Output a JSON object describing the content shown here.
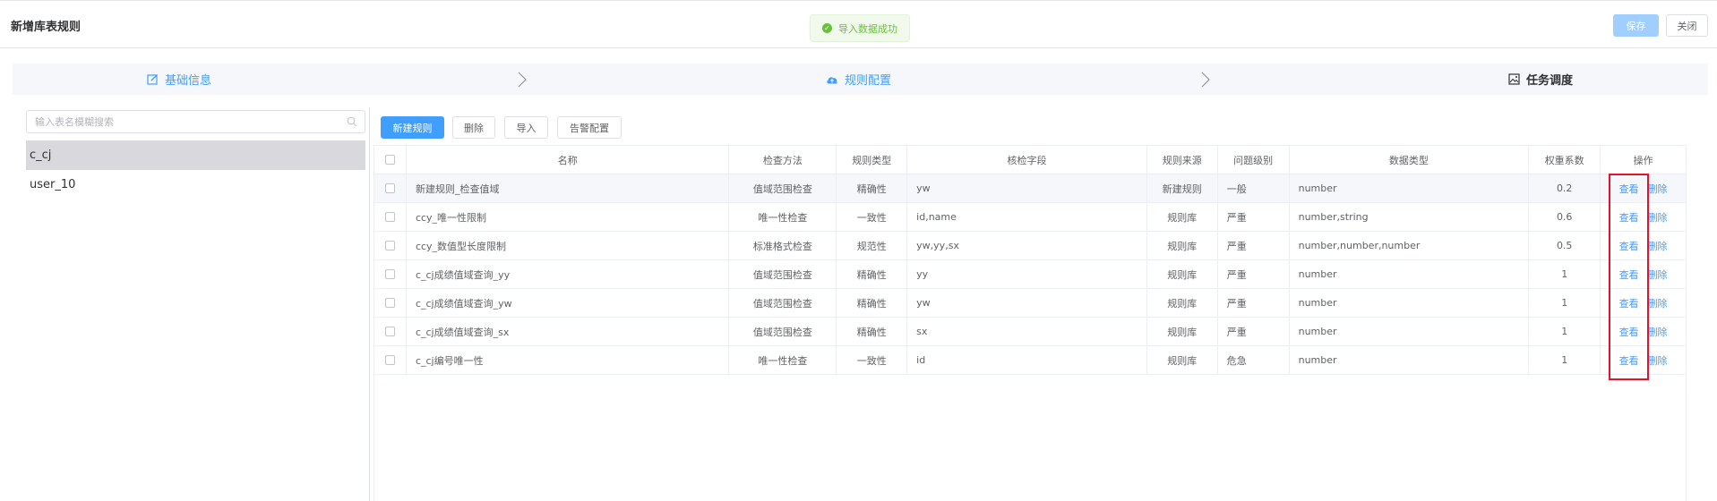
{
  "header": {
    "title": "新增库表规则",
    "toast": "导入数据成功",
    "save_label": "保存",
    "close_label": "关闭"
  },
  "steps": [
    {
      "label": "基础信息",
      "icon": "edit-icon",
      "state": "done"
    },
    {
      "label": "规则配置",
      "icon": "cloud-upload-icon",
      "state": "done"
    },
    {
      "label": "任务调度",
      "icon": "picture-icon",
      "state": "current"
    }
  ],
  "sidebar": {
    "search_placeholder": "输入表名模糊搜索",
    "tables": [
      {
        "name": "c_cj",
        "selected": true
      },
      {
        "name": "user_10",
        "selected": false
      }
    ]
  },
  "toolbar": {
    "new_rule": "新建规则",
    "delete": "删除",
    "import": "导入",
    "alarm_config": "告警配置"
  },
  "table": {
    "columns": [
      "名称",
      "检查方法",
      "规则类型",
      "核检字段",
      "规则来源",
      "问题级别",
      "数据类型",
      "权重系数",
      "操作"
    ],
    "rows": [
      {
        "name": "新建规则_检查值域",
        "method": "值域范围检查",
        "type": "精确性",
        "field": "yw",
        "source": "新建规则",
        "level": "一般",
        "dtype": "number",
        "weight": "0.2"
      },
      {
        "name": "ccy_唯一性限制",
        "method": "唯一性检查",
        "type": "一致性",
        "field": "id,name",
        "source": "规则库",
        "level": "严重",
        "dtype": "number,string",
        "weight": "0.6"
      },
      {
        "name": "ccy_数值型长度限制",
        "method": "标准格式检查",
        "type": "规范性",
        "field": "yw,yy,sx",
        "source": "规则库",
        "level": "严重",
        "dtype": "number,number,number",
        "weight": "0.5"
      },
      {
        "name": "c_cj成绩值域查询_yy",
        "method": "值域范围检查",
        "type": "精确性",
        "field": "yy",
        "source": "规则库",
        "level": "严重",
        "dtype": "number",
        "weight": "1"
      },
      {
        "name": "c_cj成绩值域查询_yw",
        "method": "值域范围检查",
        "type": "精确性",
        "field": "yw",
        "source": "规则库",
        "level": "严重",
        "dtype": "number",
        "weight": "1"
      },
      {
        "name": "c_cj成绩值域查询_sx",
        "method": "值域范围检查",
        "type": "精确性",
        "field": "sx",
        "source": "规则库",
        "level": "严重",
        "dtype": "number",
        "weight": "1"
      },
      {
        "name": "c_cj编号唯一性",
        "method": "唯一性检查",
        "type": "一致性",
        "field": "id",
        "source": "规则库",
        "level": "危急",
        "dtype": "number",
        "weight": "1"
      }
    ],
    "view_label": "查看",
    "delete_label": "删除"
  },
  "colors": {
    "primary": "#409eff",
    "success": "#67c23a",
    "highlight": "#e5132a"
  }
}
